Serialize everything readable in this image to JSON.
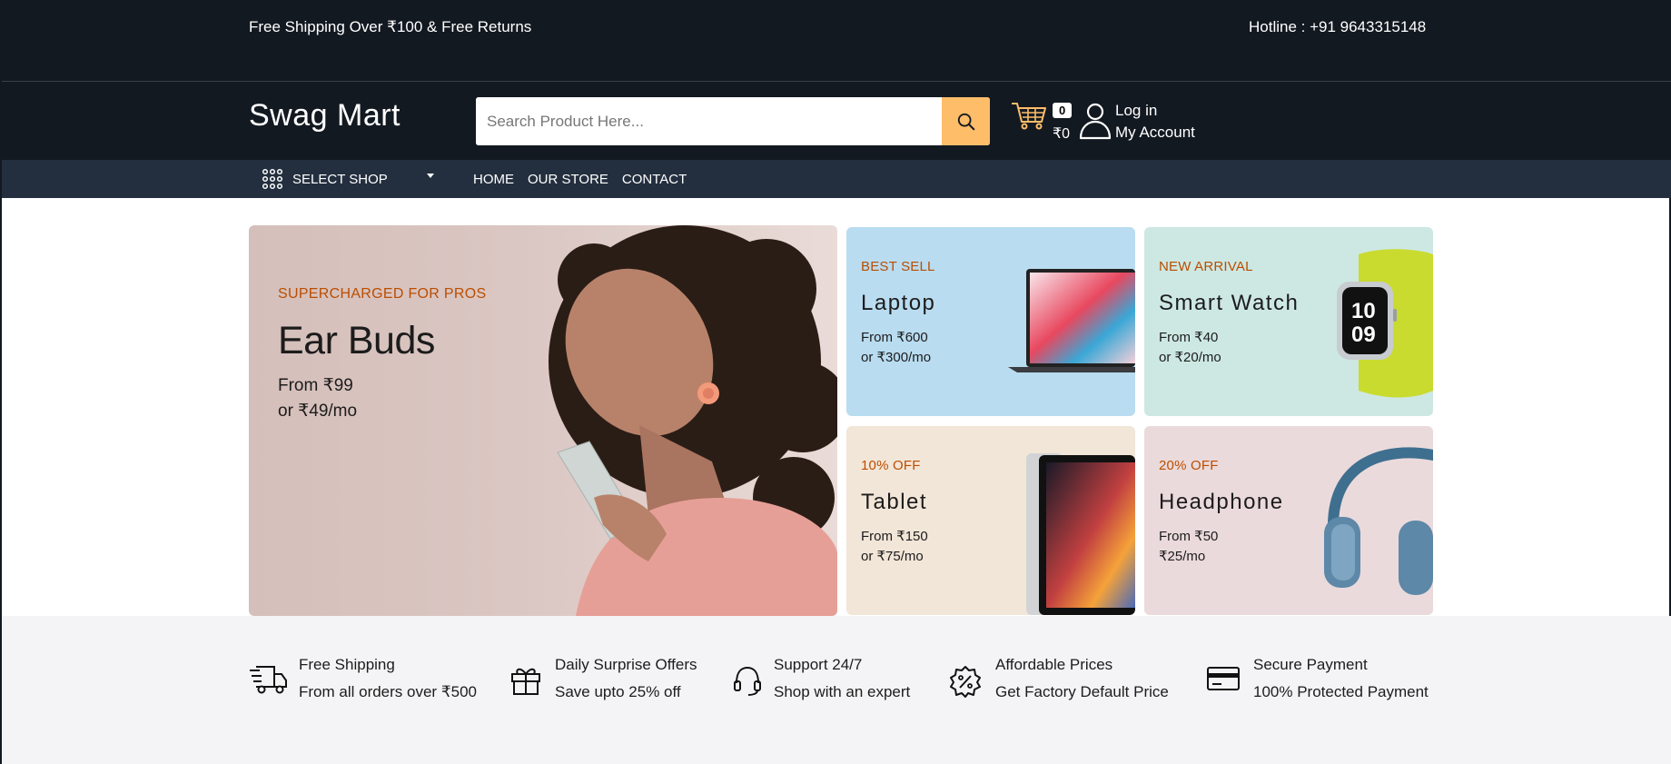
{
  "top_strip": {
    "promo": "Free Shipping Over ₹100 & Free Returns",
    "hotline": "Hotline : +91 9643315148"
  },
  "header": {
    "logo": "Swag Mart",
    "search": {
      "placeholder": "Search Product Here...",
      "value": ""
    },
    "search_icon": "search-icon",
    "cart": {
      "icon": "cart-icon",
      "count": "0",
      "total": "₹0"
    },
    "account": {
      "icon": "user-icon",
      "line1": "Log in",
      "line2": "My Account"
    }
  },
  "nav": {
    "select_shop": "SELECT SHOP",
    "links": [
      "HOME",
      "OUR STORE",
      "CONTACT"
    ]
  },
  "banners": {
    "main": {
      "tag": "SUPERCHARGED FOR PROS",
      "title": "Ear Buds",
      "price": "From ₹99",
      "monthly": "or ₹49/mo"
    },
    "small": [
      {
        "tag": "BEST SELL",
        "title": "Laptop",
        "price": "From ₹600",
        "monthly": "or ₹300/mo"
      },
      {
        "tag": "NEW ARRIVAL",
        "title": "Smart Watch",
        "price": "From ₹40",
        "monthly": "or ₹20/mo"
      },
      {
        "tag": "10% OFF",
        "title": "Tablet",
        "price": "From ₹150",
        "monthly": "or ₹75/mo"
      },
      {
        "tag": "20% OFF",
        "title": "Headphone",
        "price": "From ₹50",
        "monthly": "₹25/mo"
      }
    ]
  },
  "services": [
    {
      "icon": "truck-icon",
      "title": "Free Shipping",
      "subtitle": "From all orders over ₹500"
    },
    {
      "icon": "gift-icon",
      "title": "Daily Surprise Offers",
      "subtitle": "Save upto 25% off"
    },
    {
      "icon": "headset-icon",
      "title": "Support 24/7",
      "subtitle": "Shop with an expert"
    },
    {
      "icon": "discount-icon",
      "title": "Affordable Prices",
      "subtitle": "Get Factory Default Price"
    },
    {
      "icon": "credit-card-icon",
      "title": "Secure Payment",
      "subtitle": "100% Protected Payment"
    }
  ],
  "colors": {
    "header_bg": "#131921",
    "nav_bg": "#232f3e",
    "accent": "#febd69",
    "tag": "#bb4d00"
  }
}
